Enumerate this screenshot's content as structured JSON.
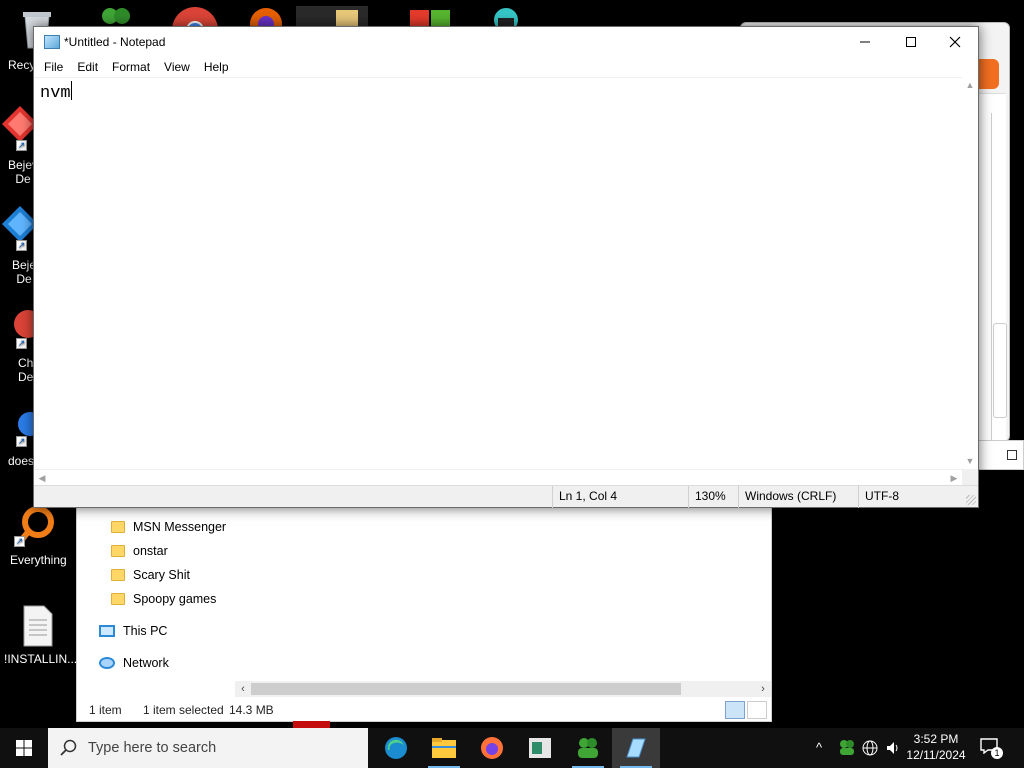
{
  "desktop": {
    "icons": [
      {
        "label": "Recy"
      },
      {
        "label": "Bejev\nDe"
      },
      {
        "label": "Beje\nDe"
      },
      {
        "label": "Ch\nDe"
      },
      {
        "label": "does"
      },
      {
        "label": "Everything"
      },
      {
        "label": "!INSTALLIN..."
      }
    ]
  },
  "explorer": {
    "tree": [
      {
        "label": "MSN Messenger",
        "icon": "folder-icon"
      },
      {
        "label": "onstar",
        "icon": "folder-icon"
      },
      {
        "label": "Scary Shit",
        "icon": "folder-icon"
      },
      {
        "label": "Spoopy games",
        "icon": "folder-icon"
      },
      {
        "label": "This PC",
        "icon": "this-pc-icon"
      },
      {
        "label": "Network",
        "icon": "network-icon"
      }
    ],
    "status": {
      "count": "1 item",
      "selected": "1 item selected",
      "size": "14.3 MB"
    }
  },
  "notepad": {
    "title": "*Untitled - Notepad",
    "menu": [
      "File",
      "Edit",
      "Format",
      "View",
      "Help"
    ],
    "text": "nvm",
    "status": {
      "position": "Ln 1, Col 4",
      "zoom": "130%",
      "line_ending": "Windows (CRLF)",
      "encoding": "UTF-8"
    }
  },
  "taskbar": {
    "search_placeholder": "Type here to search",
    "apps": [
      "edge-icon",
      "file-explorer-icon",
      "firefox-icon",
      "app-icon",
      "msn-messenger-icon",
      "notepad-icon"
    ],
    "clock": {
      "time": "3:52 PM",
      "date": "12/11/2024"
    },
    "notification_count": "1"
  },
  "colors": {
    "accent": "#76b9ed",
    "taskbar": "#101010",
    "folder": "#ffd766"
  }
}
